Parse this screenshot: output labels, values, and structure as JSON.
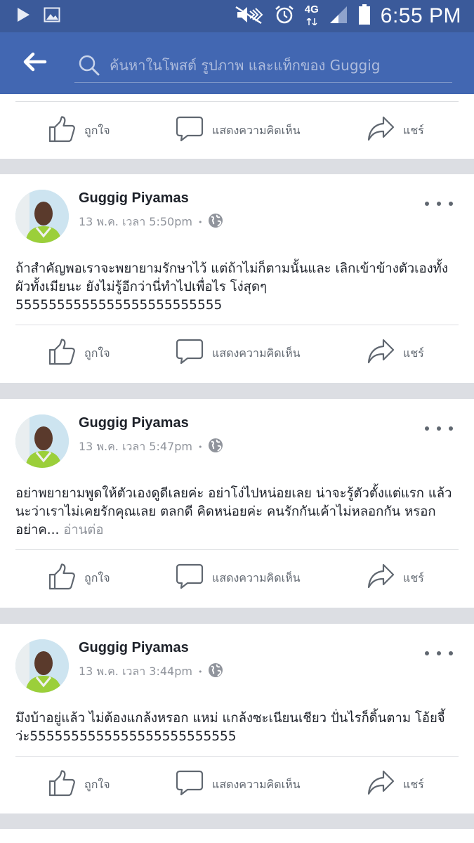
{
  "status_bar": {
    "time": "6:55 PM",
    "network": "4G"
  },
  "search": {
    "placeholder": "ค้นหาในโพสต์ รูปภาพ และแท็กของ Guggig"
  },
  "actions": {
    "like": "ถูกใจ",
    "comment": "แสดงความคิดเห็น",
    "share": "แชร์"
  },
  "posts": [
    {
      "author": "Guggig Piyamas",
      "time": "13 พ.ค. เวลา 5:50pm",
      "separator": "•",
      "text": "ถ้าสำคัญพอเราจะพยายามรักษาไว้ แต่ถ้าไม่ก็ตามนั้นและ เลิกเข้าข้างตัวเองทั้งผัวทั้งเมียนะ ยังไม่รู้อีกว่านี่ทำไปเพื่อไร โง่สุดๆ 5555555555555555555555555"
    },
    {
      "author": "Guggig Piyamas",
      "time": "13 พ.ค. เวลา 5:47pm",
      "separator": "•",
      "text": "อย่าพยายามพูดให้ตัวเองดูดีเลยค่ะ อย่าโง่ไปหน่อยเลย น่าจะรู้ตัวตั้งแต่แรก แล้วนะว่าเราไม่เคยรักคุณเลย ตลกดี คิดหน่อยค่ะ คนรักกันเค้าไม่หลอกกัน หรอก อย่าค...",
      "see_more": "อ่านต่อ"
    },
    {
      "author": "Guggig Piyamas",
      "time": "13 พ.ค. เวลา 3:44pm",
      "separator": "•",
      "text": "มึงบ้าอยู่แล้ว ไม่ต้องแกล้งหรอก แหม่ แกล้งซะเนียนเชียว ปั่นไรก็ดิ้นตาม โอ้ยจี้ว่ะ5555555555555555555555555"
    }
  ]
}
